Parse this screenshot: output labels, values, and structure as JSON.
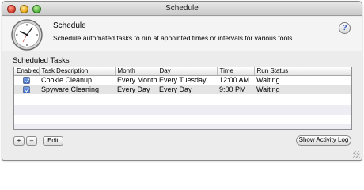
{
  "window": {
    "title": "Schedule"
  },
  "header": {
    "app_name": "Schedule",
    "description": "Schedule automated tasks to run at appointed times or intervals for various tools.",
    "help_label": "?",
    "icon": "clock-icon"
  },
  "tasks": {
    "section_label": "Scheduled Tasks",
    "columns": [
      "Enabled",
      "Task Description",
      "Month",
      "Day",
      "Time",
      "Run Status"
    ],
    "rows": [
      {
        "enabled": true,
        "task": "Cookie Cleanup",
        "month": "Every Month",
        "day": "Every Tuesday",
        "time": "12:00 AM",
        "status": "Waiting"
      },
      {
        "enabled": true,
        "task": "Spyware Cleaning",
        "month": "Every Day",
        "day": "Every Day",
        "time": "9:00 PM",
        "status": "Waiting"
      }
    ]
  },
  "buttons": {
    "add": "+",
    "remove": "–",
    "edit": "Edit",
    "show_log": "Show Activity Log"
  }
}
